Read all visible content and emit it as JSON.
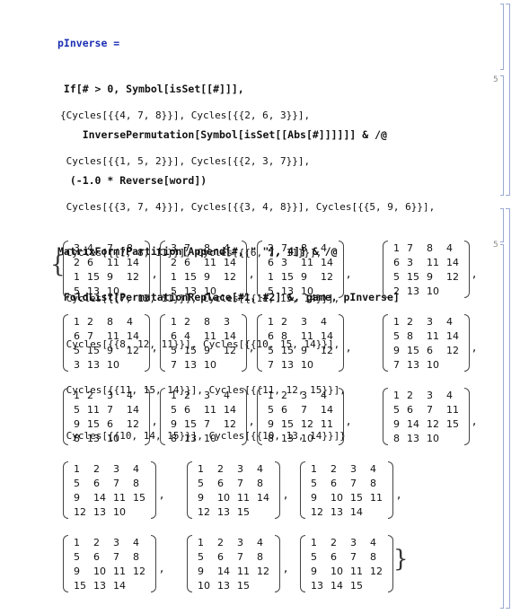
{
  "cell1": {
    "input_lines": [
      "pInverse =",
      " If[# > 0, Symbol[isSet[[#]]],",
      "    InversePermutation[Symbol[isSet[[Abs[#]]]]]] & /@",
      "  (-1.0 * Reverse[word])"
    ],
    "output_lines": [
      "{Cycles[{{4, 7, 8}}], Cycles[{{2, 6, 3}}],",
      " Cycles[{{1, 5, 2}}], Cycles[{{2, 3, 7}}],",
      " Cycles[{{3, 7, 4}}], Cycles[{{3, 4, 8}}], Cycles[{{5, 9, 6}}],",
      " Cycles[{{7, 8, 11}}], Cycles[{{6, 7, 11}}],",
      " Cycles[{{7, 12, 11}}], Cycles[{{11, 15, 14}}],",
      " Cycles[{{8, 12, 11}}], Cycles[{{10, 15, 14}}],",
      " Cycles[{{11, 15, 14}}], Cycles[{{11, 12, 15}}],",
      " Cycles[{{10, 14, 15}}], Cycles[{{10, 13, 14}}]}"
    ]
  },
  "cell2": {
    "input_lines": [
      "MatrixForm[Partition[Append[#, \" \"], 4]] & /@",
      " FoldList[PermutationReplace[#1, #2] &, game, pInverse]"
    ],
    "open_brace": "{",
    "close_brace": "}",
    "separator": ",",
    "matrices": [
      [
        [
          "3",
          "4",
          "7",
          "8"
        ],
        [
          "2",
          "6",
          "11",
          "14"
        ],
        [
          "1",
          "15",
          "9",
          "12"
        ],
        [
          "5",
          "13",
          "10",
          ""
        ]
      ],
      [
        [
          "3",
          "7",
          "8",
          "4"
        ],
        [
          "2",
          "6",
          "11",
          "14"
        ],
        [
          "1",
          "15",
          "9",
          "12"
        ],
        [
          "5",
          "13",
          "10",
          ""
        ]
      ],
      [
        [
          "2",
          "7",
          "8",
          "4"
        ],
        [
          "6",
          "3",
          "11",
          "14"
        ],
        [
          "1",
          "15",
          "9",
          "12"
        ],
        [
          "5",
          "13",
          "10",
          ""
        ]
      ],
      [
        [
          "1",
          "7",
          "8",
          "4"
        ],
        [
          "6",
          "3",
          "11",
          "14"
        ],
        [
          "5",
          "15",
          "9",
          "12"
        ],
        [
          "2",
          "13",
          "10",
          ""
        ]
      ],
      [
        [
          "1",
          "2",
          "8",
          "4"
        ],
        [
          "6",
          "7",
          "11",
          "14"
        ],
        [
          "5",
          "15",
          "9",
          "12"
        ],
        [
          "3",
          "13",
          "10",
          ""
        ]
      ],
      [
        [
          "1",
          "2",
          "8",
          "3"
        ],
        [
          "6",
          "4",
          "11",
          "14"
        ],
        [
          "5",
          "15",
          "9",
          "12"
        ],
        [
          "7",
          "13",
          "10",
          ""
        ]
      ],
      [
        [
          "1",
          "2",
          "3",
          "4"
        ],
        [
          "6",
          "8",
          "11",
          "14"
        ],
        [
          "5",
          "15",
          "9",
          "12"
        ],
        [
          "7",
          "13",
          "10",
          ""
        ]
      ],
      [
        [
          "1",
          "2",
          "3",
          "4"
        ],
        [
          "5",
          "8",
          "11",
          "14"
        ],
        [
          "9",
          "15",
          "6",
          "12"
        ],
        [
          "7",
          "13",
          "10",
          ""
        ]
      ],
      [
        [
          "1",
          "2",
          "3",
          "4"
        ],
        [
          "5",
          "11",
          "7",
          "14"
        ],
        [
          "9",
          "15",
          "6",
          "12"
        ],
        [
          "8",
          "13",
          "10",
          ""
        ]
      ],
      [
        [
          "1",
          "2",
          "3",
          "4"
        ],
        [
          "5",
          "6",
          "11",
          "14"
        ],
        [
          "9",
          "15",
          "7",
          "12"
        ],
        [
          "8",
          "13",
          "10",
          ""
        ]
      ],
      [
        [
          "1",
          "2",
          "3",
          "4"
        ],
        [
          "5",
          "6",
          "7",
          "14"
        ],
        [
          "9",
          "15",
          "12",
          "11"
        ],
        [
          "8",
          "13",
          "10",
          ""
        ]
      ],
      [
        [
          "1",
          "2",
          "3",
          "4"
        ],
        [
          "5",
          "6",
          "7",
          "11"
        ],
        [
          "9",
          "14",
          "12",
          "15"
        ],
        [
          "8",
          "13",
          "10",
          ""
        ]
      ],
      [
        [
          "1",
          "2",
          "3",
          "4"
        ],
        [
          "5",
          "6",
          "7",
          "8"
        ],
        [
          "9",
          "14",
          "11",
          "15"
        ],
        [
          "12",
          "13",
          "10",
          ""
        ]
      ],
      [
        [
          "1",
          "2",
          "3",
          "4"
        ],
        [
          "5",
          "6",
          "7",
          "8"
        ],
        [
          "9",
          "10",
          "11",
          "14"
        ],
        [
          "12",
          "13",
          "15",
          ""
        ]
      ],
      [
        [
          "1",
          "2",
          "3",
          "4"
        ],
        [
          "5",
          "6",
          "7",
          "8"
        ],
        [
          "9",
          "10",
          "15",
          "11"
        ],
        [
          "12",
          "13",
          "14",
          ""
        ]
      ],
      [
        [
          "1",
          "2",
          "3",
          "4"
        ],
        [
          "5",
          "6",
          "7",
          "8"
        ],
        [
          "9",
          "10",
          "11",
          "12"
        ],
        [
          "15",
          "13",
          "14",
          ""
        ]
      ],
      [
        [
          "1",
          "2",
          "3",
          "4"
        ],
        [
          "5",
          "6",
          "7",
          "8"
        ],
        [
          "9",
          "14",
          "11",
          "12"
        ],
        [
          "10",
          "13",
          "15",
          ""
        ]
      ],
      [
        [
          "1",
          "2",
          "3",
          "4"
        ],
        [
          "5",
          "6",
          "7",
          "8"
        ],
        [
          "9",
          "10",
          "11",
          "12"
        ],
        [
          "13",
          "14",
          "15",
          ""
        ]
      ]
    ]
  },
  "bracket_marks": {
    "cell1_out": "5",
    "cell2_out": "5"
  }
}
